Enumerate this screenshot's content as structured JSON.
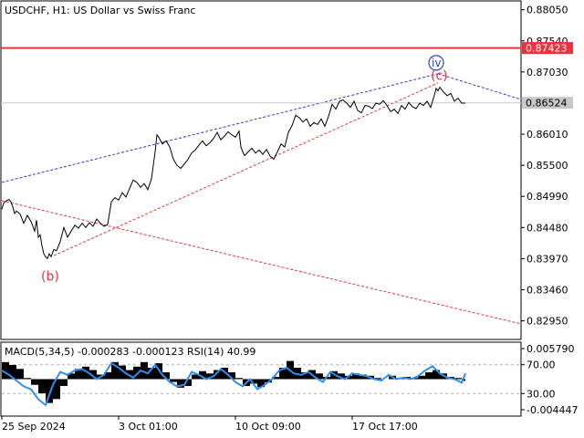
{
  "window": {
    "symbol_line": "USDCHF, H1:  US Dollar vs Swiss Franc"
  },
  "chart_data": {
    "type": "line",
    "title": "USDCHF, H1:  US Dollar vs Swiss Franc",
    "price_axis": {
      "ylim": [
        0.8266,
        0.8818
      ],
      "ticks": [
        "0.88050",
        "0.87540",
        "0.87030",
        "0.86010",
        "0.85500",
        "0.84990",
        "0.84480",
        "0.83970",
        "0.83460",
        "0.82950"
      ]
    },
    "time_axis": {
      "ticks": [
        "25 Sep 2024",
        "3 Oct 01:00",
        "10 Oct 09:00",
        "17 Oct 17:00"
      ]
    },
    "price_series": {
      "name": "USDCHF",
      "x": [
        0,
        2,
        5,
        8,
        10,
        12,
        14,
        16,
        20,
        24,
        28,
        32,
        36,
        38,
        40,
        42,
        44,
        46,
        48,
        50,
        52,
        54,
        57,
        60,
        64,
        68,
        72,
        76,
        80,
        84,
        88,
        92,
        96,
        100,
        104,
        108,
        112,
        116,
        120,
        124,
        128,
        132,
        136,
        140,
        144,
        148,
        152,
        156,
        160,
        164,
        166,
        168,
        170,
        172,
        176,
        180,
        184,
        188,
        192,
        196,
        200,
        204,
        208,
        212,
        216,
        220,
        224,
        228,
        232,
        236,
        240,
        244,
        248,
        252,
        256,
        260,
        262,
        264,
        266,
        270,
        274,
        278,
        282,
        286,
        290,
        294,
        298,
        302,
        306,
        310,
        314,
        318,
        322,
        326,
        330,
        334,
        338,
        342,
        346,
        350,
        354,
        358,
        362,
        366,
        370,
        374,
        378,
        382,
        386,
        390,
        394,
        398,
        402,
        406,
        410,
        414,
        418,
        422,
        426,
        430,
        434,
        438,
        442,
        446,
        450,
        454,
        458,
        462,
        466,
        470,
        474,
        476,
        478,
        480,
        484,
        488,
        492,
        496,
        500,
        504,
        508
      ],
      "y": [
        0.8478,
        0.8488,
        0.8492,
        0.8494,
        0.849,
        0.8482,
        0.8471,
        0.8475,
        0.847,
        0.8455,
        0.8468,
        0.8458,
        0.8442,
        0.846,
        0.8432,
        0.8436,
        0.8418,
        0.8405,
        0.84,
        0.8397,
        0.8405,
        0.84,
        0.8412,
        0.841,
        0.8425,
        0.8448,
        0.8432,
        0.8442,
        0.8452,
        0.8447,
        0.8455,
        0.8448,
        0.8456,
        0.845,
        0.8462,
        0.8455,
        0.845,
        0.8453,
        0.849,
        0.8497,
        0.8493,
        0.8505,
        0.8498,
        0.8512,
        0.8526,
        0.8522,
        0.8514,
        0.852,
        0.851,
        0.8528,
        0.855,
        0.8572,
        0.86,
        0.8596,
        0.8585,
        0.859,
        0.858,
        0.856,
        0.855,
        0.8545,
        0.8552,
        0.856,
        0.857,
        0.8575,
        0.8583,
        0.859,
        0.8582,
        0.8587,
        0.8594,
        0.8604,
        0.8592,
        0.8598,
        0.8605,
        0.86,
        0.8596,
        0.8606,
        0.858,
        0.8572,
        0.8566,
        0.8572,
        0.8578,
        0.857,
        0.8575,
        0.8568,
        0.8576,
        0.8565,
        0.856,
        0.8572,
        0.8585,
        0.858,
        0.8604,
        0.8615,
        0.8632,
        0.8628,
        0.8621,
        0.8626,
        0.8614,
        0.862,
        0.8617,
        0.8626,
        0.8614,
        0.863,
        0.865,
        0.8642,
        0.8655,
        0.8657,
        0.8652,
        0.8645,
        0.8655,
        0.864,
        0.8636,
        0.8648,
        0.8647,
        0.8643,
        0.8652,
        0.865,
        0.8656,
        0.8648,
        0.8638,
        0.8642,
        0.8635,
        0.8648,
        0.8642,
        0.8653,
        0.8646,
        0.8643,
        0.8652,
        0.8648,
        0.8655,
        0.8645,
        0.8665,
        0.8676,
        0.8672,
        0.8678,
        0.867,
        0.8664,
        0.8668,
        0.8655,
        0.866,
        0.8652,
        0.8652
      ]
    },
    "resistance_level": {
      "value": 0.87423,
      "label": "0.87423",
      "color": "#e8343c"
    },
    "current_price": {
      "value": 0.86524,
      "label": "0.86524"
    },
    "wave_labels": [
      {
        "text": "(b)",
        "x": 57,
        "y": 0.8397,
        "color": "#e8343c"
      },
      {
        "text": "(c)",
        "x": 478,
        "y": 0.8678,
        "color": "#e8343c"
      },
      {
        "text": "iv",
        "x": 476,
        "y": 0.8712,
        "color": "#2a3fd4"
      }
    ],
    "trend_lines": [
      {
        "name": "channel-upper",
        "color": "#2a3fd4",
        "from": [
          0,
          0.8522
        ],
        "to": [
          478,
          0.87
        ]
      },
      {
        "name": "projection-down",
        "color": "#2a3fd4",
        "from": [
          478,
          0.87
        ],
        "to": [
          570,
          0.8658
        ]
      },
      {
        "name": "channel-lower",
        "color": "#e8343c",
        "from": [
          57,
          0.8402
        ],
        "to": [
          478,
          0.8685
        ]
      },
      {
        "name": "long-down",
        "color": "#e8343c",
        "from": [
          0,
          0.8492
        ],
        "to": [
          570,
          0.829
        ]
      }
    ],
    "indicator": {
      "label": "MACD(5,34,5) -0.000283 -0.000123 RSI(14) 40.99",
      "axis_ticks": [
        "0.005790",
        "70.00",
        "30.00",
        "-0.004447"
      ],
      "levels": [
        70,
        30
      ],
      "ylim": [
        0,
        100
      ],
      "series": [
        {
          "name": "RSI(14)",
          "color": "#2f8ff0",
          "x": [
            0,
            8,
            16,
            24,
            32,
            40,
            48,
            56,
            64,
            72,
            80,
            88,
            96,
            104,
            112,
            120,
            128,
            136,
            144,
            152,
            160,
            168,
            176,
            184,
            192,
            200,
            208,
            216,
            224,
            232,
            240,
            248,
            256,
            264,
            272,
            280,
            288,
            296,
            304,
            312,
            320,
            328,
            336,
            344,
            352,
            360,
            368,
            376,
            384,
            392,
            400,
            408,
            416,
            424,
            432,
            440,
            448,
            456,
            464,
            472,
            480,
            488,
            496,
            504,
            508
          ],
          "y": [
            62,
            56,
            48,
            40,
            36,
            22,
            14,
            42,
            60,
            56,
            62,
            64,
            58,
            50,
            56,
            72,
            66,
            58,
            52,
            62,
            58,
            70,
            56,
            46,
            40,
            42,
            60,
            56,
            50,
            54,
            64,
            56,
            46,
            40,
            50,
            36,
            42,
            50,
            62,
            66,
            58,
            56,
            60,
            52,
            46,
            60,
            54,
            50,
            58,
            56,
            54,
            50,
            48,
            56,
            50,
            52,
            50,
            54,
            62,
            68,
            58,
            52,
            50,
            45,
            58
          ]
        }
      ],
      "macd_histogram": {
        "name": "MACD(5,34,5)",
        "color": "#000000",
        "x": [
          0,
          8,
          16,
          24,
          32,
          40,
          48,
          56,
          64,
          72,
          80,
          88,
          96,
          104,
          112,
          120,
          128,
          136,
          144,
          152,
          160,
          168,
          176,
          184,
          192,
          200,
          208,
          216,
          224,
          232,
          240,
          248,
          256,
          264,
          272,
          280,
          288,
          296,
          304,
          312,
          320,
          328,
          336,
          344,
          352,
          360,
          368,
          376,
          384,
          392,
          400,
          408,
          416,
          424,
          432,
          440,
          448,
          456,
          464,
          472,
          480,
          488,
          496,
          504,
          508
        ],
        "y": [
          0.003,
          0.0025,
          0.0018,
          0.0002,
          -0.001,
          -0.0025,
          -0.0042,
          -0.0035,
          -0.0012,
          0.001,
          0.0018,
          0.0022,
          0.0016,
          0.0008,
          0.0012,
          0.003,
          0.0024,
          0.0016,
          0.0022,
          0.003,
          0.002,
          0.0028,
          0.0012,
          -0.0005,
          -0.0015,
          -0.0012,
          0.0008,
          0.0014,
          0.001,
          0.0016,
          0.002,
          0.0012,
          0.0002,
          -0.0012,
          -0.0008,
          -0.0014,
          -0.0006,
          0.0004,
          0.002,
          0.0032,
          0.002,
          0.0012,
          0.0016,
          0.001,
          0.0004,
          0.0014,
          0.001,
          0.0006,
          0.001,
          0.0008,
          0.0006,
          0.0002,
          0.0,
          0.0006,
          0.0002,
          0.0004,
          0.0002,
          0.0006,
          0.0012,
          0.0016,
          0.001,
          0.0004,
          0.0002,
          -0.0003,
          0.0002
        ]
      }
    }
  }
}
